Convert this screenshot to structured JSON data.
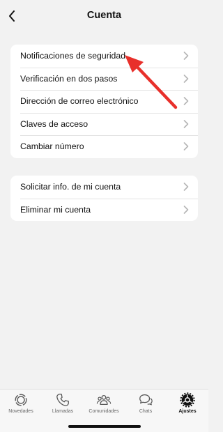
{
  "header": {
    "title": "Cuenta"
  },
  "sections": [
    {
      "items": [
        {
          "label": "Notificaciones de seguridad"
        },
        {
          "label": "Verificación en dos pasos"
        },
        {
          "label": "Dirección de correo electrónico"
        },
        {
          "label": "Claves de acceso"
        },
        {
          "label": "Cambiar número"
        }
      ]
    },
    {
      "items": [
        {
          "label": "Solicitar info. de mi cuenta"
        },
        {
          "label": "Eliminar mi cuenta"
        }
      ]
    }
  ],
  "annotation": {
    "type": "arrow",
    "color": "#e8302b",
    "points_to": "Notificaciones de seguridad"
  },
  "tabbar": {
    "tabs": [
      {
        "label": "Novedades",
        "icon": "status-icon"
      },
      {
        "label": "Llamadas",
        "icon": "phone-icon"
      },
      {
        "label": "Comunidades",
        "icon": "people-icon"
      },
      {
        "label": "Chats",
        "icon": "chat-bubbles-icon"
      },
      {
        "label": "Ajustes",
        "icon": "gear-icon",
        "active": true
      }
    ]
  },
  "colors": {
    "background": "#f2f2f2",
    "card": "#ffffff",
    "text": "#111111",
    "chevron": "#b5b5b5",
    "annotation": "#e8302b"
  }
}
